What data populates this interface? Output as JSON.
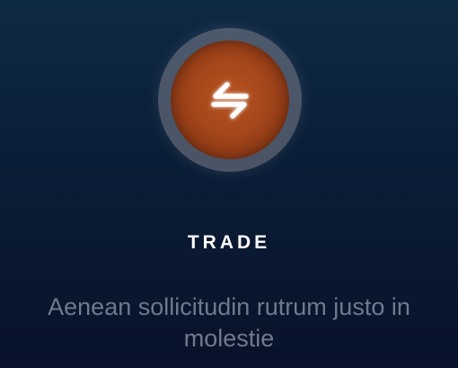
{
  "card": {
    "icon": "exchange-arrows-icon",
    "title": "TRADE",
    "description": "Aenean sollicitudin rutrum justo in molestie"
  },
  "colors": {
    "background_top": "#0f2a44",
    "background_bottom": "#08122a",
    "icon_ring": "#8c8c96",
    "icon_fill": "#a3461a",
    "icon_glyph": "#ffffff",
    "title": "#ffffff",
    "description": "#6f7a8c"
  }
}
